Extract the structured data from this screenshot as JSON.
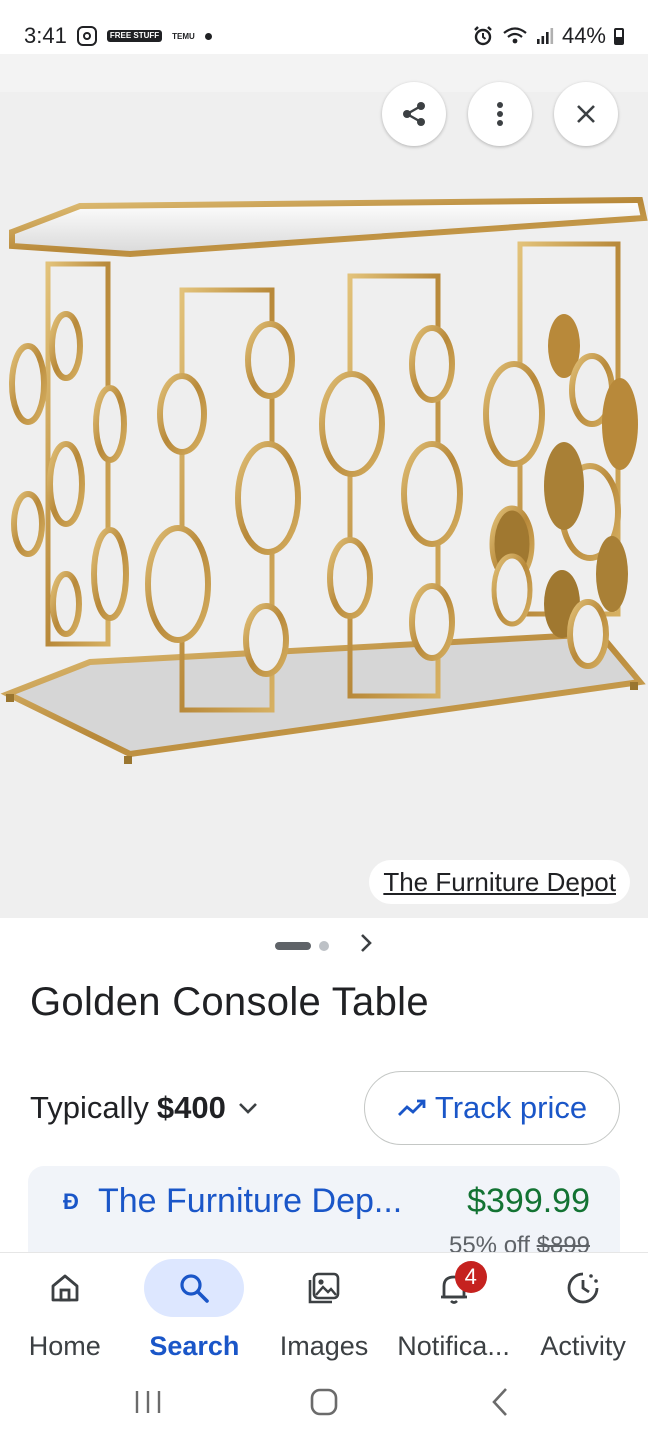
{
  "status_bar": {
    "time": "3:41",
    "free_badge": "FREE STUFF",
    "temu_badge": "TEMU",
    "battery": "44%",
    "battery_level": 0.44
  },
  "image_viewer": {
    "source_label": "The Furniture Depot",
    "buttons": [
      "share-icon",
      "more-vert-icon",
      "close-icon"
    ],
    "carousel_index": 1,
    "carousel_total": 2
  },
  "product": {
    "title": "Golden Console Table",
    "typically_prefix": "Typically",
    "typical_price": "$400",
    "track_price_label": "Track price"
  },
  "offer": {
    "store_logo": "Ð",
    "store_name": "The Furniture Dep...",
    "price": "$399.99",
    "discount": "55% off",
    "original_price": "$899"
  },
  "bottom_nav": {
    "items": [
      {
        "label": "Home",
        "icon": "home-icon"
      },
      {
        "label": "Search",
        "icon": "search-icon"
      },
      {
        "label": "Images",
        "icon": "images-icon"
      },
      {
        "label": "Notifica...",
        "icon": "bell-icon",
        "badge": "4"
      },
      {
        "label": "Activity",
        "icon": "activity-icon"
      }
    ],
    "active": "Search"
  },
  "colors": {
    "accent_blue": "#1a56c8",
    "price_green": "#137333",
    "badge_red": "#c5221f",
    "gold": "#c9a04a"
  }
}
